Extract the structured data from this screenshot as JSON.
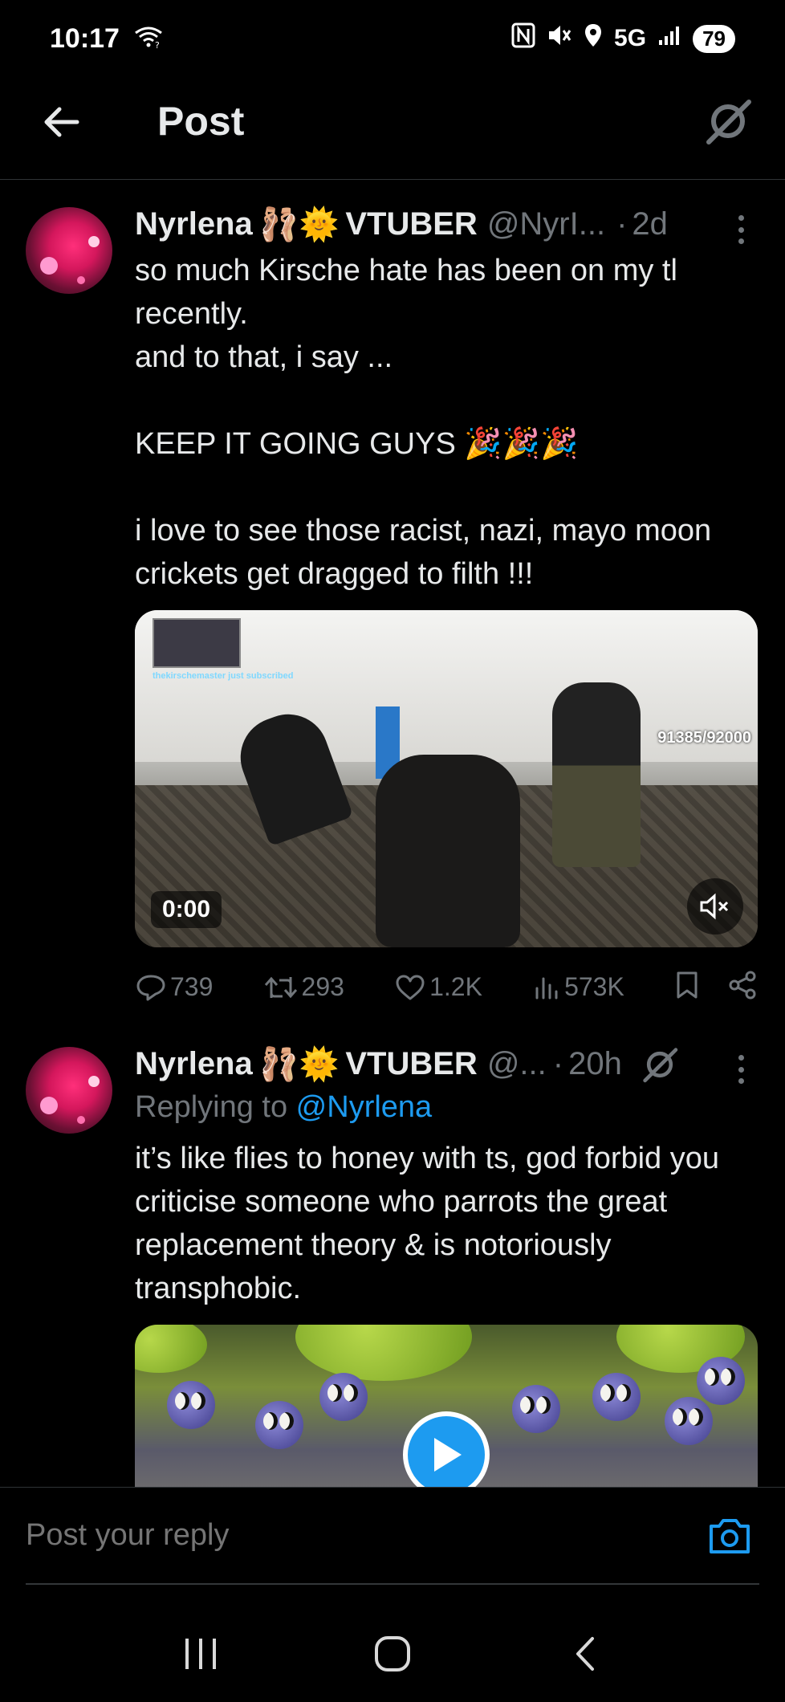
{
  "status_bar": {
    "time": "10:17",
    "network": "5G",
    "battery": "79",
    "icons": [
      "wifi-icon",
      "nfc-icon",
      "mute-icon",
      "location-icon",
      "signal-icon",
      "battery-icon"
    ]
  },
  "header": {
    "title": "Post"
  },
  "tweets": [
    {
      "display_name": "Nyrlena",
      "emojis": "🩰🌞",
      "name_suffix": "VTUBER",
      "handle": "@NyrI...",
      "dot": "·",
      "time": "2d",
      "text": "so much Kirsche hate has been on my tl recently.\nand to that, i say ...\n\nKEEP IT GOING GUYS 🎉🎉🎉\n\ni love to see those racist, nazi, mayo moon crickets get dragged to filth !!!",
      "video": {
        "timestamp": "0:00",
        "overlay_counter": "91385/92000",
        "overlay_caption": "thekirschemaster just subscribed"
      },
      "actions": {
        "replies": "739",
        "reposts": "293",
        "likes": "1.2K",
        "views": "573K"
      }
    },
    {
      "display_name": "Nyrlena",
      "emojis": "🩰🌞",
      "name_suffix": "VTUBER",
      "handle": "@...",
      "dot": "·",
      "time": "20h",
      "replying_label": "Replying to ",
      "replying_mention": "@Nyrlena",
      "text": "it’s like flies to honey with ts, god forbid you criticise someone who parrots the great replacement theory & is notoriously transphobic."
    }
  ],
  "composer": {
    "placeholder": "Post your reply"
  },
  "colors": {
    "background": "#000000",
    "text": "#e7e9ea",
    "muted": "#71767b",
    "accent": "#1d9bf0",
    "divider": "#2f3336"
  }
}
